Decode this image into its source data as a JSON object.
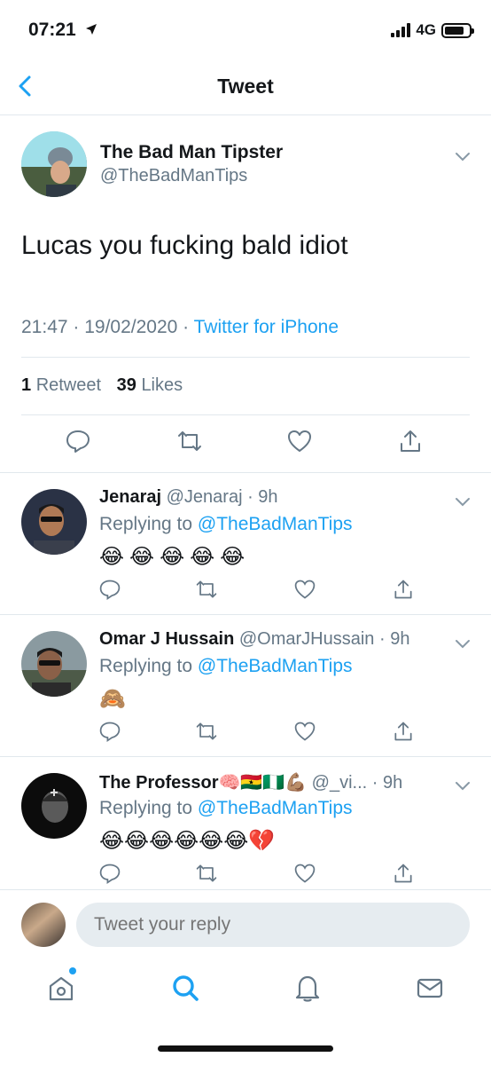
{
  "status_bar": {
    "time": "07:21",
    "network": "4G"
  },
  "header": {
    "title": "Tweet"
  },
  "tweet": {
    "author_name": "The Bad Man Tipster",
    "author_handle": "@TheBadManTips",
    "text": "Lucas you fucking bald idiot",
    "timestamp": "21:47 · 19/02/2020 · ",
    "source": "Twitter for iPhone",
    "retweet_count": "1",
    "retweet_label": "Retweet",
    "like_count": "39",
    "like_label": "Likes"
  },
  "replies": [
    {
      "name": "Jenaraj",
      "handle_time": "@Jenaraj · 9h",
      "replying_prefix": "Replying to ",
      "replying_to": "@TheBadManTips",
      "body": "😂😂😂😂😂"
    },
    {
      "name": "Omar J Hussain",
      "handle_time": "@OmarJHussain · 9h",
      "replying_prefix": "Replying to ",
      "replying_to": "@TheBadManTips",
      "body": "🙈"
    },
    {
      "name": "The Professor🧠🇬🇭🇳🇬💪🏽",
      "handle_time": "@_vi...  · 9h",
      "replying_prefix": "Replying to ",
      "replying_to": "@TheBadManTips",
      "body": "😂😂😂😂😂😂💔"
    }
  ],
  "reply_bar": {
    "placeholder": "Tweet your reply"
  },
  "colors": {
    "accent": "#1da1f2",
    "secondary_text": "#657786",
    "divider": "#e1e8ed"
  },
  "tabs": [
    "home-icon",
    "search-icon",
    "notifications-icon",
    "messages-icon"
  ]
}
